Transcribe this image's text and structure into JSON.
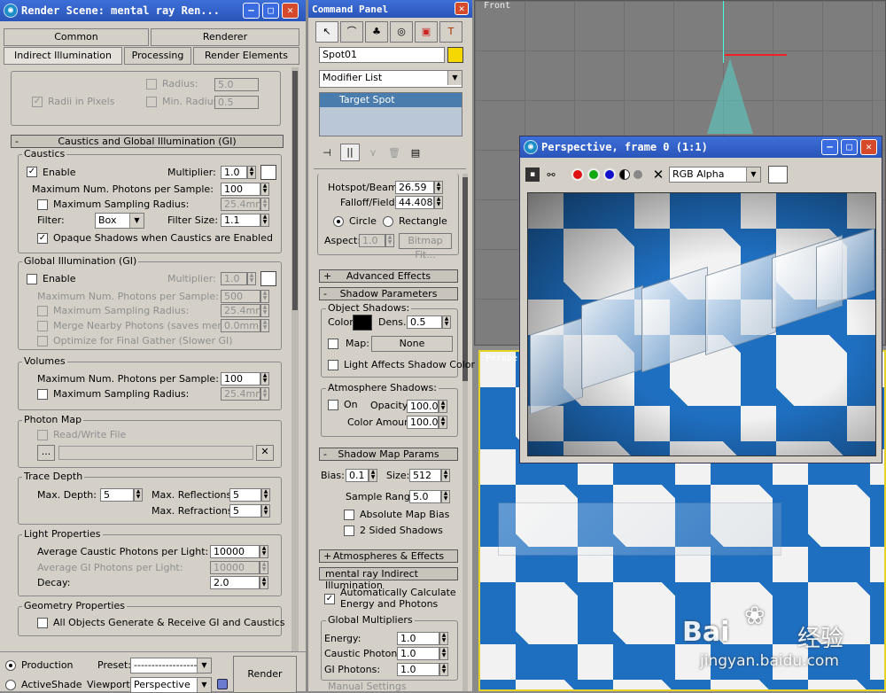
{
  "render_window": {
    "title": "Render Scene: mental ray Ren...",
    "tabs_row1": [
      "Common",
      "Renderer"
    ],
    "tabs_row2": [
      "Indirect Illumination",
      "Processing",
      "Render Elements"
    ],
    "top": {
      "radius_label": "Radius:",
      "radius_value": "5.0",
      "radii_in_pixels": "Radii in Pixels",
      "min_radius_label": "Min. Radius:",
      "min_radius_value": "0.5"
    },
    "rollout_title": "Caustics and Global Illumination (GI)",
    "collapse_sign": "-",
    "caustics": {
      "title": "Caustics",
      "enable": "Enable",
      "multiplier_label": "Multiplier:",
      "multiplier": "1.0",
      "max_photons_label": "Maximum Num. Photons per Sample:",
      "max_photons": "100",
      "max_radius_label": "Maximum Sampling Radius:",
      "max_radius": "25.4mm",
      "filter_label": "Filter:",
      "filter": "Box",
      "filter_size_label": "Filter Size:",
      "filter_size": "1.1",
      "opaque": "Opaque Shadows when Caustics are Enabled"
    },
    "gi": {
      "title": "Global Illumination (GI)",
      "enable": "Enable",
      "multiplier_label": "Multiplier:",
      "multiplier": "1.0",
      "max_photons_label": "Maximum Num. Photons per Sample:",
      "max_photons": "500",
      "max_radius_label": "Maximum Sampling Radius:",
      "max_radius": "25.4mm",
      "merge_label": "Merge Nearby Photons (saves memory):",
      "merge": "0.0mm",
      "optimize": "Optimize for Final Gather (Slower GI)"
    },
    "volumes": {
      "title": "Volumes",
      "max_photons_label": "Maximum Num. Photons per Sample:",
      "max_photons": "100",
      "max_radius_label": "Maximum Sampling Radius:",
      "max_radius": "25.4mm"
    },
    "photon_map": {
      "title": "Photon Map",
      "read_write": "Read/Write File",
      "browse": "...",
      "clear": "✕"
    },
    "trace": {
      "title": "Trace Depth",
      "max_depth_label": "Max. Depth:",
      "max_depth": "5",
      "max_refl_label": "Max. Reflections:",
      "max_refl": "5",
      "max_refr_label": "Max. Refractions:",
      "max_refr": "5"
    },
    "light": {
      "title": "Light Properties",
      "avg_caustic_label": "Average Caustic Photons per Light:",
      "avg_caustic": "10000",
      "avg_gi_label": "Average GI Photons per Light:",
      "avg_gi": "10000",
      "decay_label": "Decay:",
      "decay": "2.0"
    },
    "geometry": {
      "title": "Geometry Properties",
      "all_objects": "All Objects Generate & Receive GI and Caustics"
    },
    "bottom": {
      "production": "Production",
      "activeshade": "ActiveShade",
      "preset_label": "Preset:",
      "preset": "--------------------",
      "viewport_label": "Viewport:",
      "viewport": "Perspective",
      "render": "Render"
    }
  },
  "command_panel": {
    "title": "Command Panel",
    "object_name": "Spot01",
    "modifier_list": "Modifier List",
    "stack_item": "Target Spot",
    "hotspot_label": "Hotspot/Beam:",
    "hotspot": "26.59",
    "falloff_label": "Falloff/Field:",
    "falloff": "44.408",
    "circle": "Circle",
    "rectangle": "Rectangle",
    "aspect_label": "Aspect:",
    "aspect": "1.0",
    "bitmap_fit": "Bitmap Fit...",
    "advanced_effects": "Advanced Effects",
    "shadow_params": "Shadow Parameters",
    "object_shadows": "Object Shadows:",
    "color_label": "Color:",
    "dens_label": "Dens.",
    "dens": "0.5",
    "map_label": "Map:",
    "map_value": "None",
    "light_affects": "Light Affects Shadow Color",
    "atmos_shadows": "Atmosphere Shadows:",
    "on_label": "On",
    "opacity_label": "Opacity:",
    "opacity": "100.0",
    "color_amount_label": "Color Amount:",
    "color_amount": "100.0",
    "shadow_map_params": "Shadow Map Params",
    "bias_label": "Bias:",
    "bias": "0.1",
    "size_label": "Size:",
    "size": "512",
    "sample_range_label": "Sample Range:",
    "sample_range": "5.0",
    "absolute_bias": "Absolute Map Bias",
    "two_sided": "2 Sided Shadows",
    "atmos_effects": "Atmospheres & Effects",
    "mr_indirect": "mental ray Indirect Illumination",
    "auto_calc_1": "Automatically Calculate",
    "auto_calc_2": "Energy and Photons",
    "global_mult": "Global Multipliers",
    "energy_label": "Energy:",
    "energy": "1.0",
    "caustic_photons_label": "Caustic Photons:",
    "caustic_photons": "1.0",
    "gi_photons_label": "GI Photons:",
    "gi_photons": "1.0",
    "manual_settings": "Manual Settings"
  },
  "viewports": {
    "front_label": "Front",
    "persp_label": "Perspe"
  },
  "frame_window": {
    "title": "Perspective, frame 0 (1:1)",
    "channel": "RGB Alpha"
  },
  "watermark": {
    "brand": "Bai",
    "brand_cn": "经验",
    "url": "jingyan.baidu.com"
  },
  "colors": {
    "title_blue": "#2a55b9",
    "object_color": "#f5d800",
    "checker_blue": "#1f6fc1"
  }
}
